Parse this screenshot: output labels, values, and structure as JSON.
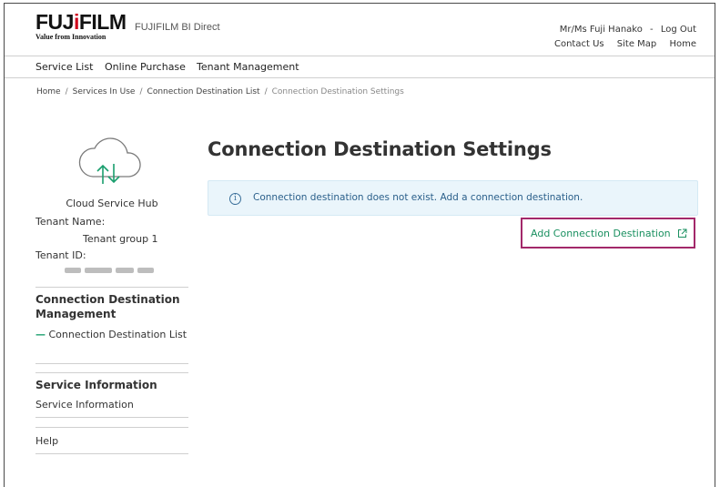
{
  "header": {
    "logo_prefix": "FUJ",
    "logo_accent": "i",
    "logo_suffix": "FILM",
    "logo_tagline": "Value from Innovation",
    "brand_name": "FUJIFILM BI Direct",
    "user_name": "Mr/Ms Fuji Hanako",
    "user_separator": "-",
    "logout_label": "Log Out",
    "links": [
      "Contact Us",
      "Site Map",
      "Home"
    ]
  },
  "global_nav": {
    "items": [
      "Service List",
      "Online Purchase",
      "Tenant Management"
    ]
  },
  "breadcrumb": {
    "items": [
      "Home",
      "Services In Use",
      "Connection Destination List",
      "Connection Destination Settings"
    ],
    "separator": "/"
  },
  "sidebar": {
    "hub_name": "Cloud Service Hub",
    "tenant_name_label": "Tenant Name:",
    "tenant_name_value": "Tenant group 1",
    "tenant_id_label": "Tenant ID:",
    "section_connection": "Connection Destination Management",
    "menu_connection_list": "Connection Destination List",
    "menu_dash": "—",
    "section_service": "Service Information",
    "menu_service_info": "Service Information",
    "menu_help": "Help"
  },
  "main": {
    "title": "Connection Destination Settings",
    "info_message": "Connection destination does not exist. Add a connection destination.",
    "info_icon_glyph": "i",
    "add_button_label": "Add Connection Destination"
  },
  "icons": {
    "cloud": "cloud-sync-icon",
    "info": "info-icon",
    "external": "external-link-icon"
  },
  "colors": {
    "accent_green": "#1a9e6e",
    "brand_red": "#d0021b",
    "highlight_border": "#a3286a",
    "info_background": "#eaf5fb",
    "info_text": "#2a5f8a"
  }
}
